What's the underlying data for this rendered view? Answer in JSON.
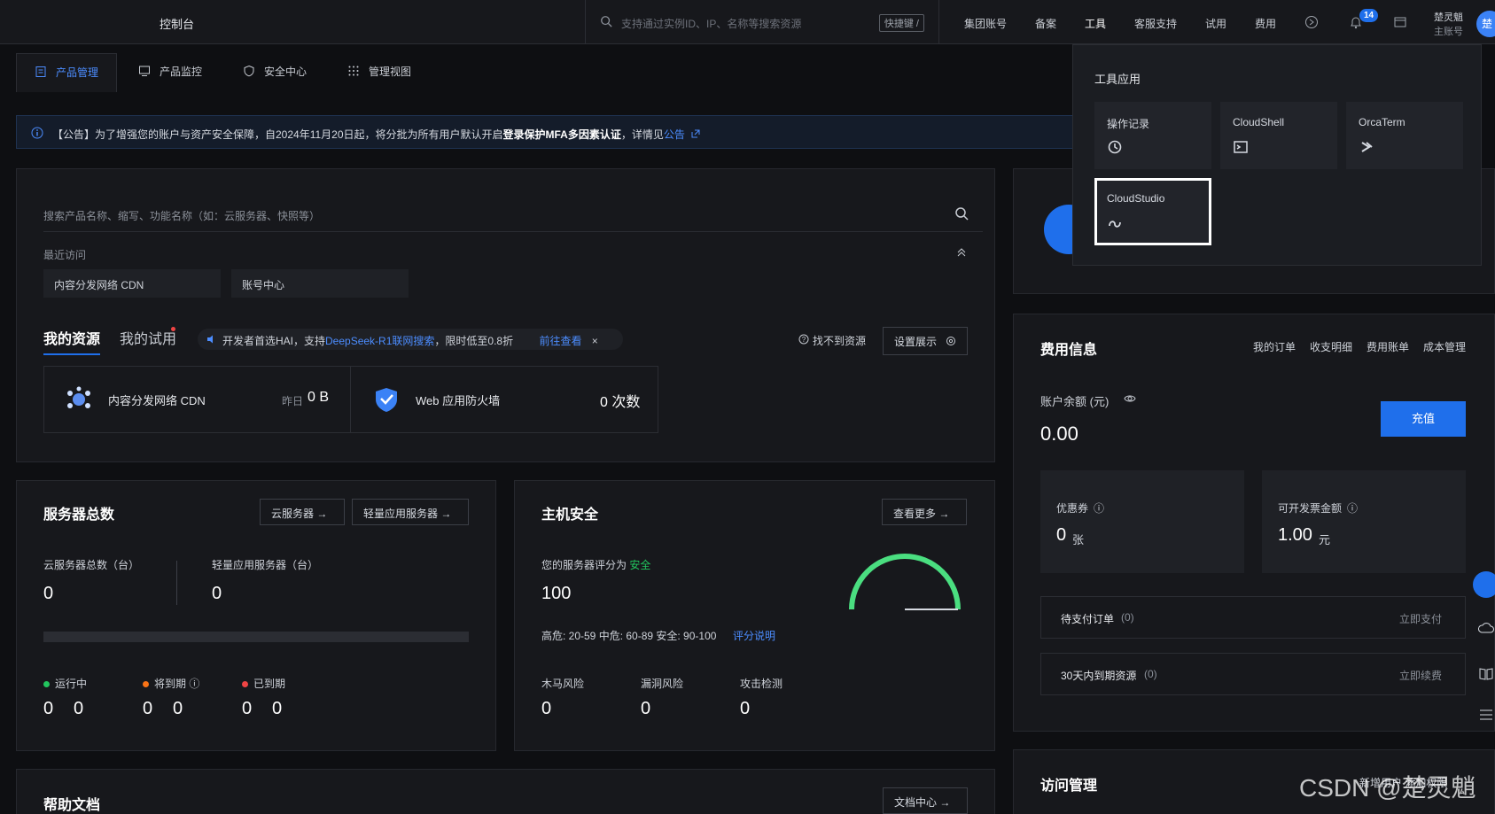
{
  "topbar": {
    "brand": "控制台",
    "search_placeholder": "支持通过实例ID、IP、名称等搜索资源",
    "shortcut": "快捷键 /",
    "nav": [
      "集团账号",
      "备案",
      "工具",
      "客服支持",
      "试用",
      "费用"
    ],
    "notification_count": "14",
    "user_name": "楚灵魈",
    "user_role": "主账号",
    "avatar_text": "楚"
  },
  "tabs": [
    "产品管理",
    "产品监控",
    "安全中心",
    "管理视图"
  ],
  "notice": {
    "prefix": "【公告】为了增强您的账户与资产安全保障，自2024年11月20日起，将分批为所有用户默认开启",
    "bold": "登录保护MFA多因素认证",
    "suffix": "，详情见",
    "link": "公告"
  },
  "products": {
    "search_placeholder": "搜索产品名称、缩写、功能名称（如：云服务器、快照等）",
    "recent_label": "最近访问",
    "recent": [
      "内容分发网络 CDN",
      "账号中心"
    ],
    "tab_resources": "我的资源",
    "tab_trials": "我的试用",
    "promo_text": "开发者首选HAI，支持",
    "promo_link": "DeepSeek-R1联网搜索",
    "promo_suffix": "，限时低至0.8折",
    "promo_action": "前往查看",
    "cant_find": "找不到资源",
    "settings": "设置展示",
    "cards": [
      {
        "name": "内容分发网络 CDN",
        "meta": "昨日",
        "value": "0 B"
      },
      {
        "name": "Web 应用防火墙",
        "meta": "",
        "value": "0 次数"
      }
    ]
  },
  "servers": {
    "title": "服务器总数",
    "btn_cvm": "云服务器",
    "btn_light": "轻量应用服务器",
    "cvm_label": "云服务器总数（台）",
    "cvm_value": "0",
    "light_label": "轻量应用服务器（台）",
    "light_value": "0",
    "status": [
      {
        "label": "运行中",
        "a": "0",
        "b": "0",
        "color": "#22c55e"
      },
      {
        "label": "将到期",
        "a": "0",
        "b": "0",
        "color": "#f97316"
      },
      {
        "label": "已到期",
        "a": "0",
        "b": "0",
        "color": "#ef4444"
      }
    ]
  },
  "host_security": {
    "title": "主机安全",
    "more": "查看更多",
    "score_label": "您的服务器评分为",
    "score_state": "安全",
    "score": "100",
    "ranges": "高危: 20-59   中危: 60-89   安全: 90-100",
    "ranges_link": "评分说明",
    "risks": [
      {
        "label": "木马风险",
        "value": "0"
      },
      {
        "label": "漏洞风险",
        "value": "0"
      },
      {
        "label": "攻击检测",
        "value": "0"
      }
    ],
    "gauge_level": 1.0
  },
  "help": {
    "title": "帮助文档",
    "docs": "文档中心"
  },
  "billing": {
    "title": "费用信息",
    "links": [
      "我的订单",
      "收支明细",
      "费用账单",
      "成本管理"
    ],
    "balance_label": "账户余额 (元)",
    "balance": "0.00",
    "recharge": "充值",
    "coupon_label": "优惠券",
    "coupon_value": "0",
    "coupon_unit": "张",
    "invoice_label": "可开发票金额",
    "invoice_value": "1.00",
    "invoice_unit": "元",
    "pending_label": "待支付订单",
    "pending_count": "(0)",
    "pending_action": "立即支付",
    "expiring_label": "30天内到期资源",
    "expiring_count": "(0)",
    "expiring_action": "立即续费"
  },
  "access": {
    "title": "访问管理",
    "links": "新增用户   添加权限"
  },
  "dropdown": {
    "title": "工具应用",
    "items": [
      "操作记录",
      "CloudShell",
      "OrcaTerm",
      "CloudStudio"
    ]
  },
  "watermark": "CSDN @楚灵魈",
  "colors": {
    "accent": "#1f6feb",
    "link": "#4c8dff",
    "safe": "#22c55e"
  }
}
